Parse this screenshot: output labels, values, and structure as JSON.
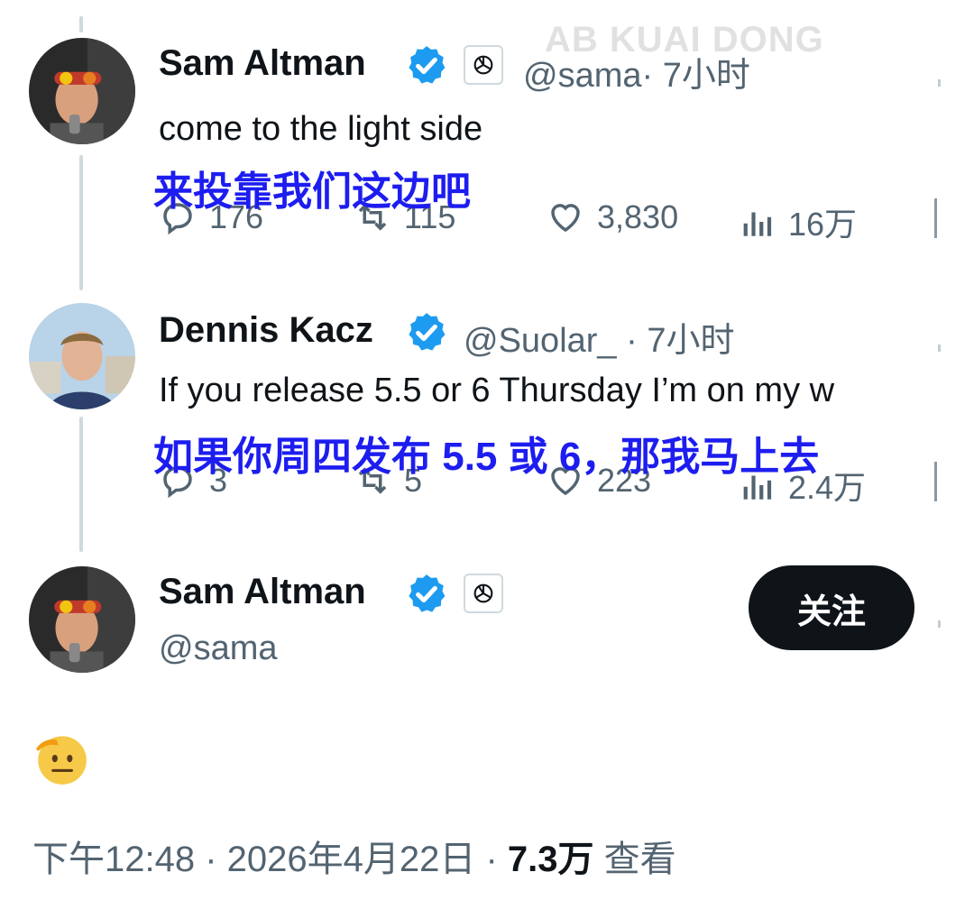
{
  "watermark": "AB KUAI DONG",
  "tweets": [
    {
      "name": "Sam Altman",
      "handle": "@sama",
      "time": "· 7小时",
      "text": "come to the light side",
      "translation": "来投靠我们这边吧",
      "replies": "176",
      "retweets": "115",
      "likes": "3,830",
      "views": "16万"
    },
    {
      "name": "Dennis Kacz",
      "handle": "@Suolar_",
      "time": "· 7小时",
      "text": "If you release 5.5 or 6 Thursday I’m on my w",
      "translation": "如果你周四发布 5.5 或 6，那我马上去",
      "replies": "3",
      "retweets": "5",
      "likes": "223",
      "views": "2.4万"
    }
  ],
  "main": {
    "name": "Sam Altman",
    "handle": "@sama",
    "follow_label": "关注",
    "emoji_icon": "saluting-face-icon",
    "timestamp": "下午12:48 · 2026年4月22日 · ",
    "views_count": "7.3万",
    "views_label": " 查看"
  },
  "colors": {
    "verified": "#1d9bf0",
    "overlay_text": "#1d1df0",
    "follow_bg": "#0f1419"
  }
}
